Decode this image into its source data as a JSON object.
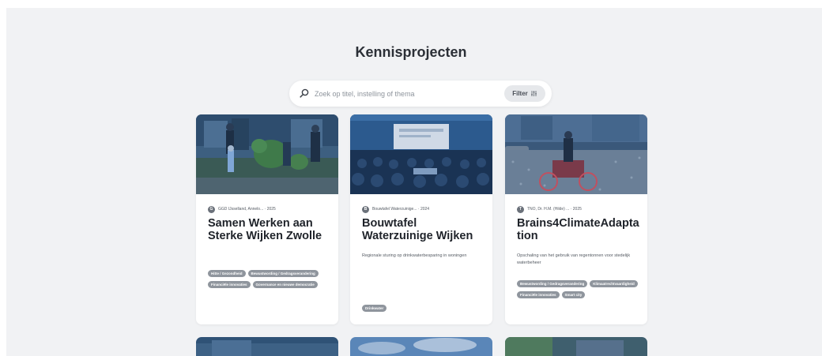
{
  "page": {
    "title": "Kennisprojecten"
  },
  "search": {
    "placeholder": "Zoek op titel, instelling of thema",
    "value": "",
    "filter_label": "Filter"
  },
  "cards": [
    {
      "avatar_letter": "G",
      "meta": "GGD IJsselland, Annelo... · 2025",
      "title": "Samen Werken aan Sterke Wijken Zwolle",
      "description": "",
      "tags": [
        "Hitte / Gezondheid",
        "Bewustwording / Gedragsverandering",
        "Financiële innovaties",
        "Governance en nieuwe democratie"
      ]
    },
    {
      "avatar_letter": "B",
      "meta": "Bouwtafel Waterzuinige... · 2024",
      "title": "Bouwtafel Waterzuinige Wijken",
      "description": "Regionale sturing op drinkwaterbesparing in woningen",
      "tags": [
        "Drinkwater"
      ]
    },
    {
      "avatar_letter": "T",
      "meta": "TNO, Dr. H.M. (Hilde) ... · 2025",
      "title": "Brains4ClimateAdaptation",
      "description": "Opschaling van het gebruik van regentonnen voor stedelijk waterbeheer",
      "tags": [
        "Bewustwording / Gedragsverandering",
        "Klimaatrechtvaardigheid",
        "Financiële innovaties",
        "Smart city"
      ]
    }
  ],
  "colors": {
    "tag": "#8f959d",
    "page_bg": "#f1f2f4",
    "image_tint": "#1f4f86"
  }
}
